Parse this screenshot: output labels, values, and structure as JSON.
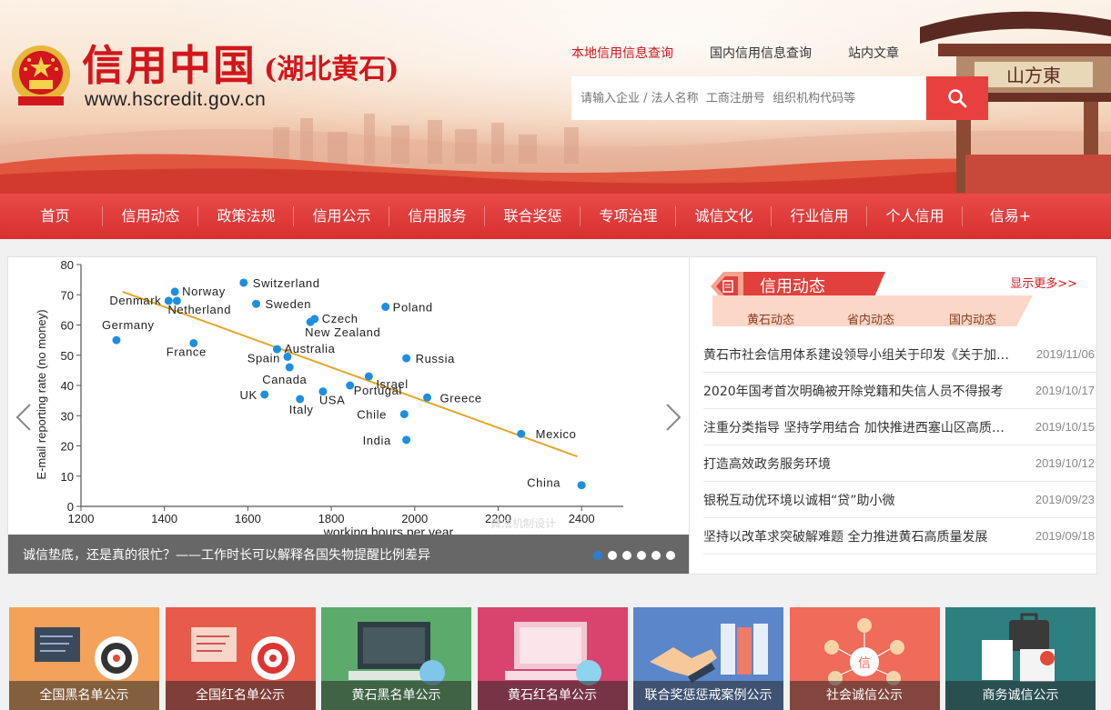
{
  "site": {
    "title": "信用中国",
    "subtitle": "(湖北黄石)",
    "url": "www.hscredit.gov.cn"
  },
  "search": {
    "tabs": [
      "本地信用信息查询",
      "国内信用信息查询",
      "站内文章"
    ],
    "active_tab": 0,
    "placeholder": "请输入企业 / 法人名称  工商注册号  组织机构代码等"
  },
  "nav": [
    "首页",
    "信用动态",
    "政策法规",
    "信用公示",
    "信用服务",
    "联合奖惩",
    "专项治理",
    "诚信文化",
    "行业信用",
    "个人信用",
    "信易+"
  ],
  "slider": {
    "caption": "诚信垫底，还是真的很忙？——工作时长可以解释各国失物提醒比例差异",
    "watermark": "舞法机制设计",
    "slide_count": 6,
    "active_slide": 0
  },
  "chart_data": {
    "type": "scatter",
    "xlabel": "working hours per year",
    "ylabel": "E-mail reporting rate (no money)",
    "xlim": [
      1200,
      2500
    ],
    "ylim": [
      0,
      80
    ],
    "xticks": [
      1200,
      1400,
      1600,
      1800,
      2000,
      2200,
      2400
    ],
    "yticks": [
      0,
      10,
      20,
      30,
      40,
      50,
      60,
      70,
      80
    ],
    "points": [
      {
        "label": "Switzerland",
        "x": 1590,
        "y": 74
      },
      {
        "label": "Norway",
        "x": 1425,
        "y": 71
      },
      {
        "label": "Denmark",
        "x": 1410,
        "y": 68
      },
      {
        "label": "Netherland",
        "x": 1430,
        "y": 68
      },
      {
        "label": "Sweden",
        "x": 1620,
        "y": 67
      },
      {
        "label": "Poland",
        "x": 1930,
        "y": 66
      },
      {
        "label": "Czech",
        "x": 1760,
        "y": 62
      },
      {
        "label": "New Zealand",
        "x": 1750,
        "y": 61
      },
      {
        "label": "Germany",
        "x": 1285,
        "y": 55
      },
      {
        "label": "France",
        "x": 1470,
        "y": 54
      },
      {
        "label": "Australia",
        "x": 1670,
        "y": 52
      },
      {
        "label": "Spain",
        "x": 1695,
        "y": 49.5
      },
      {
        "label": "Russia",
        "x": 1980,
        "y": 49
      },
      {
        "label": "Canada",
        "x": 1700,
        "y": 46
      },
      {
        "label": "Israel",
        "x": 1890,
        "y": 43
      },
      {
        "label": "Portugal",
        "x": 1845,
        "y": 40
      },
      {
        "label": "USA",
        "x": 1780,
        "y": 38
      },
      {
        "label": "UK",
        "x": 1640,
        "y": 37
      },
      {
        "label": "Italy",
        "x": 1725,
        "y": 35.5
      },
      {
        "label": "Greece",
        "x": 2030,
        "y": 36
      },
      {
        "label": "Chile",
        "x": 1975,
        "y": 30.5
      },
      {
        "label": "Mexico",
        "x": 2255,
        "y": 24
      },
      {
        "label": "India",
        "x": 1980,
        "y": 22
      },
      {
        "label": "China",
        "x": 2400,
        "y": 7
      }
    ],
    "trendline": {
      "x": [
        1300,
        2390
      ],
      "y": [
        71,
        16.5
      ]
    },
    "colors": {
      "points": "#1f8ee0",
      "trend": "#e0a82a",
      "axis": "#555555"
    }
  },
  "news": {
    "title": "信用动态",
    "more": "显示更多>>",
    "tabs": [
      "黄石动态",
      "省内动态",
      "国内动态"
    ],
    "active_tab": 0,
    "items": [
      {
        "title": "黄石市社会信用体系建设领导小组关于印发《关于加快推进...",
        "date": "2019/11/06"
      },
      {
        "title": "2020年国考首次明确被开除党籍和失信人员不得报考",
        "date": "2019/10/17"
      },
      {
        "title": "注重分类指导 坚持学用结合 加快推进西塞山区高质量发展",
        "date": "2019/10/15"
      },
      {
        "title": "打造高效政务服务环境",
        "date": "2019/10/12"
      },
      {
        "title": "银税互动优环境以诚相“贷”助小微",
        "date": "2019/09/23"
      },
      {
        "title": "坚持以改革求突破解难题 全力推进黄石高质量发展",
        "date": "2019/09/18"
      }
    ]
  },
  "tiles": [
    {
      "label": "全国黑名单公示",
      "color": "#f4a25a"
    },
    {
      "label": "全国红名单公示",
      "color": "#e85a4a"
    },
    {
      "label": "黄石黑名单公示",
      "color": "#5dab6c"
    },
    {
      "label": "黄石红名单公示",
      "color": "#d8446e"
    },
    {
      "label": "联合奖惩惩戒案例公示",
      "color": "#5b86c9"
    },
    {
      "label": "社会诚信公示",
      "color": "#ef6b5a"
    },
    {
      "label": "商务诚信公示",
      "color": "#2e7f80"
    }
  ],
  "colors": {
    "brand_red": "#d2161c",
    "nav_red": "#e03c3b",
    "search_btn": "#e8403f"
  }
}
